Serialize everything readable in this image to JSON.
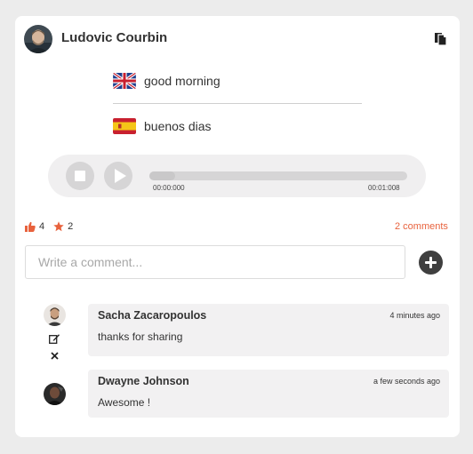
{
  "post": {
    "author": "Ludovic Courbin",
    "icons": {
      "avatar": "avatar",
      "copy": "copy-icon"
    }
  },
  "translations": [
    {
      "flag": "uk-flag-icon",
      "text": "good morning"
    },
    {
      "flag": "spain-flag-icon",
      "text": "buenos dias"
    }
  ],
  "player": {
    "current_time": "00:00:000",
    "duration": "00:01:008",
    "progress": 0.1
  },
  "stats": {
    "likes": "4",
    "stars": "2",
    "comments_link": "2 comments"
  },
  "comment_box": {
    "placeholder": "Write a comment..."
  },
  "comments": [
    {
      "name": "Sacha Zacaropoulos",
      "time": "4 minutes ago",
      "text": "thanks for sharing"
    },
    {
      "name": "Dwayne Johnson",
      "time": "a few seconds ago",
      "text": "Awesome !"
    }
  ],
  "colors": {
    "accent": "#e8623d",
    "card_bg": "#ffffff",
    "page_bg": "#ececec",
    "bubble_bg": "#f2f1f2"
  }
}
